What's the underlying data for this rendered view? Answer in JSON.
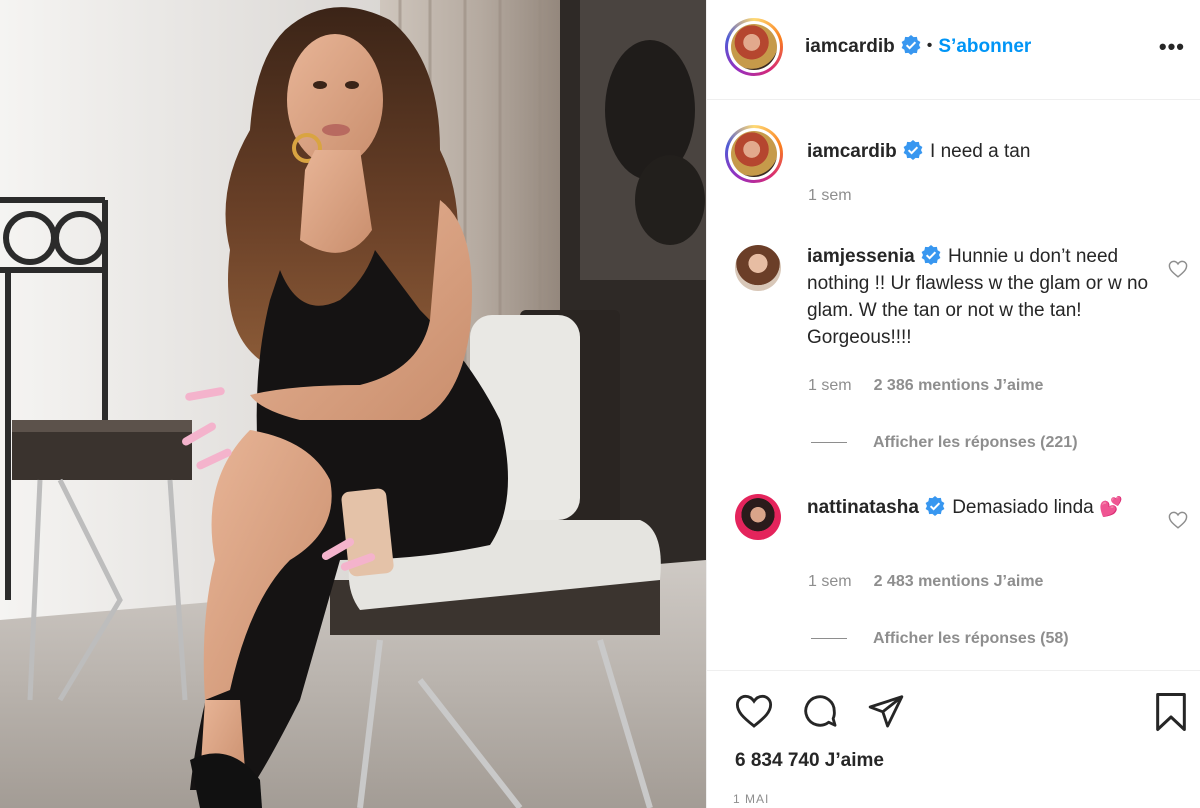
{
  "header": {
    "username": "iamcardib",
    "follow_label": "S’abonner",
    "separator": "•",
    "more_icon": "more-horizontal-icon"
  },
  "caption": {
    "username": "iamcardib",
    "text": "I need a tan",
    "time": "1 sem"
  },
  "comments": [
    {
      "username": "iamjessenia",
      "text": "Hunnie u don’t need nothing !! Ur flawless w the glam or w no glam. W the tan or not w the tan! Gorgeous!!!!",
      "time": "1 sem",
      "likes": "2 386 mentions J’aime",
      "replies": "Afficher les réponses (221)"
    },
    {
      "username": "nattinatasha",
      "text": "Demasiado linda 💕",
      "time": "1 sem",
      "likes": "2 483 mentions J’aime",
      "replies": "Afficher les réponses (58)"
    }
  ],
  "footer": {
    "likes": "6 834 740 J’aime",
    "date": "1 MAI",
    "icons": [
      "heart-icon",
      "comment-icon",
      "share-icon",
      "bookmark-icon"
    ]
  },
  "colors": {
    "link_blue": "#0095f6",
    "verified_blue": "#3897f0",
    "muted": "#8e8e8e",
    "text": "#262626"
  }
}
